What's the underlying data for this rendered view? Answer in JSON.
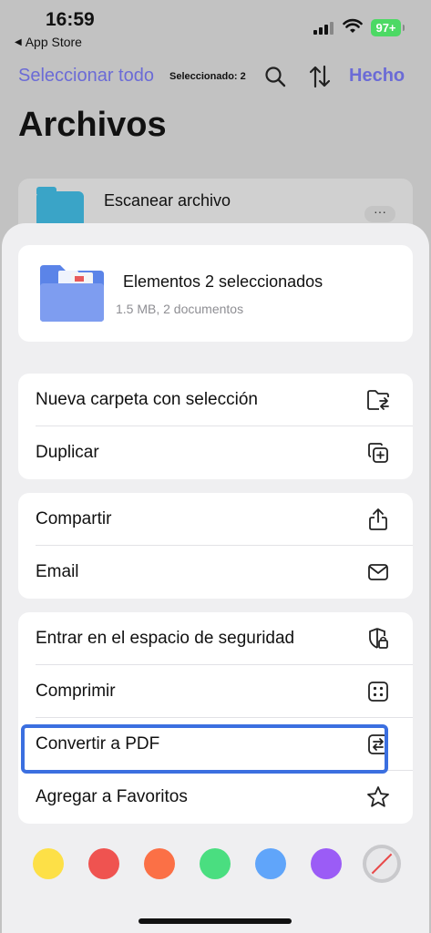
{
  "status_bar": {
    "time": "16:59",
    "back_label": "App Store",
    "battery": "97+"
  },
  "toolbar": {
    "select_all": "Seleccionar todo",
    "selected_count": "Seleccionado: 2",
    "done": "Hecho",
    "search_icon": "search-icon",
    "sort_icon": "sort-icon"
  },
  "page": {
    "title": "Archivos"
  },
  "background_file": {
    "name": "Escanear archivo",
    "more": "···"
  },
  "sheet": {
    "summary": {
      "title": "Elementos 2 seleccionados",
      "subtitle": "1.5 MB, 2 documentos"
    },
    "group1": [
      {
        "label": "Nueva carpeta con selección",
        "icon": "folder-move-icon"
      },
      {
        "label": "Duplicar",
        "icon": "duplicate-icon"
      }
    ],
    "group2": [
      {
        "label": "Compartir",
        "icon": "share-icon"
      },
      {
        "label": "Email",
        "icon": "mail-icon"
      }
    ],
    "group3": [
      {
        "label": "Entrar en el espacio de seguridad",
        "icon": "shield-lock-icon"
      },
      {
        "label": "Comprimir",
        "icon": "compress-icon"
      },
      {
        "label": "Convertir a PDF",
        "icon": "convert-icon"
      },
      {
        "label": "Agregar a Favoritos",
        "icon": "star-icon"
      }
    ],
    "highlighted_item": "Convertir a PDF",
    "colors": [
      "#fde047",
      "#ef5350",
      "#fb7046",
      "#4ade80",
      "#60a5fa",
      "#9b5cf6"
    ]
  }
}
